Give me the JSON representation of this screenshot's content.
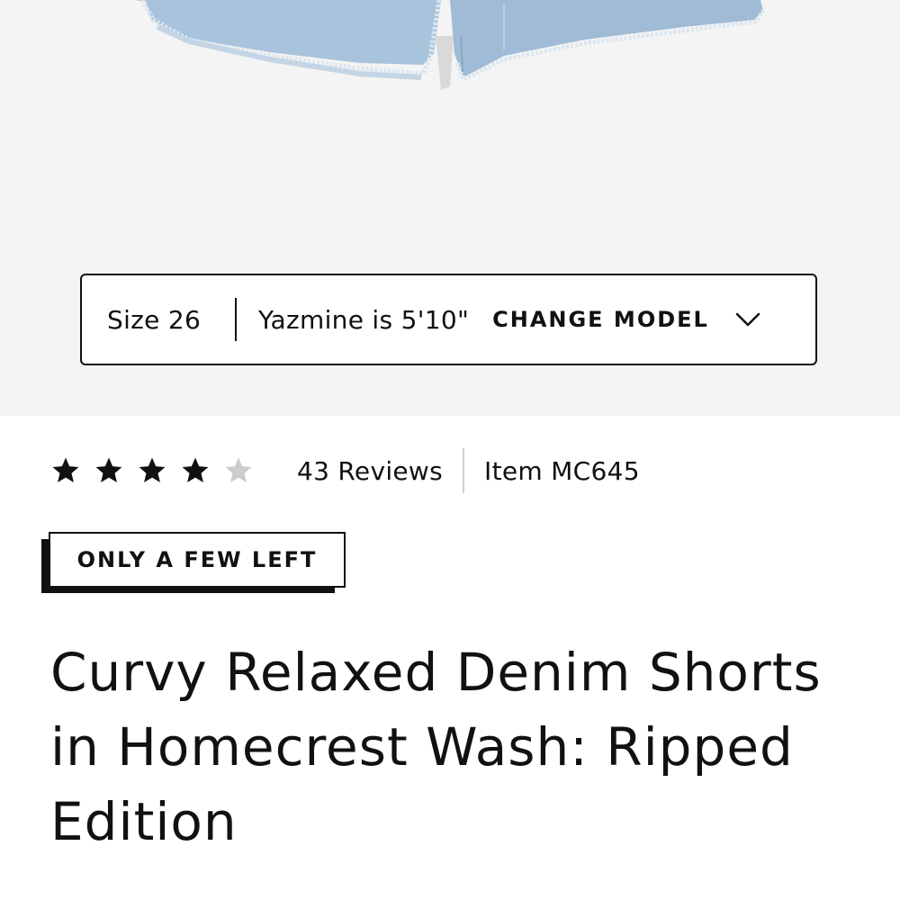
{
  "product_image": {
    "alt": "denim-shorts-image"
  },
  "model_bar": {
    "size_label": "Size 26",
    "model_label": "Yazmine is 5'10\"",
    "change_model_label": "CHANGE MODEL",
    "chevron_icon": "chevron-down-icon"
  },
  "rating": {
    "value": 4,
    "max": 5,
    "reviews_label": "43 Reviews",
    "item_label": "Item MC645",
    "filled_color": "#111111",
    "empty_color": "#cccccc"
  },
  "badge": {
    "label": "ONLY A FEW LEFT"
  },
  "product": {
    "title": "Curvy Relaxed Denim Shorts in Homecrest Wash: Ripped Edition"
  },
  "colors": {
    "image_background": "#f4f4f4",
    "denim": "#a9c3dc",
    "text": "#111111"
  }
}
